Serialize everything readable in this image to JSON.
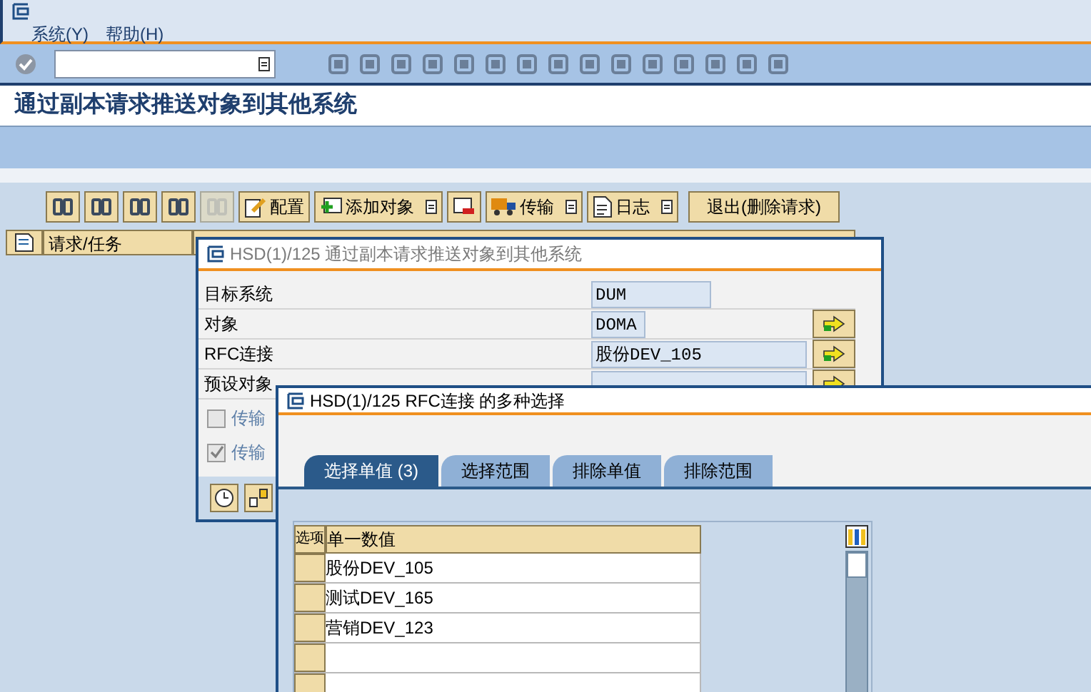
{
  "menu": [
    {
      "label": "系统(Y)"
    },
    {
      "label": "帮助(H)"
    }
  ],
  "screen_title": "通过副本请求推送对象到其他系统",
  "main_toolbar": [
    {
      "kind": "icon",
      "disabled": false
    },
    {
      "kind": "icon",
      "disabled": false
    },
    {
      "kind": "icon",
      "disabled": false
    },
    {
      "kind": "icon",
      "disabled": false
    },
    {
      "kind": "icon",
      "disabled": true
    },
    {
      "kind": "text",
      "label": "配置"
    },
    {
      "kind": "menu",
      "label": "添加对象"
    },
    {
      "kind": "icon",
      "disabled": false
    },
    {
      "kind": "menu",
      "label": "传输"
    },
    {
      "kind": "menu",
      "label": "日志"
    },
    {
      "kind": "text",
      "label": "退出(删除请求)"
    }
  ],
  "grid": {
    "columns": [
      "请求/任务"
    ]
  },
  "dialog_1": {
    "title": "HSD(1)/125 通过副本请求推送对象到其他系统",
    "fields": [
      {
        "label": "目标系统",
        "value": "DUM",
        "jump": false
      },
      {
        "label": "对象",
        "value": "DOMA",
        "jump": true
      },
      {
        "label": "RFC连接",
        "value": "股份DEV_105",
        "jump": true
      },
      {
        "label": "预设对象",
        "jump": true
      }
    ],
    "checkboxes": [
      {
        "label": "传输",
        "checked": false
      },
      {
        "label": "传输",
        "checked": true
      }
    ]
  },
  "dialog_2": {
    "title": "HSD(1)/125 RFC连接 的多种选择",
    "tabs": [
      {
        "label": "选择单值 (3)",
        "selected": true
      },
      {
        "label": "选择范围",
        "selected": false
      },
      {
        "label": "排除单值",
        "selected": false
      },
      {
        "label": "排除范围",
        "selected": false
      }
    ],
    "table": {
      "columns": [
        "选项",
        "单一数值"
      ],
      "rows": [
        {
          "value": "股份DEV_105"
        },
        {
          "value": "测试DEV_165"
        },
        {
          "value": "营销DEV_123"
        },
        {},
        {}
      ]
    }
  }
}
